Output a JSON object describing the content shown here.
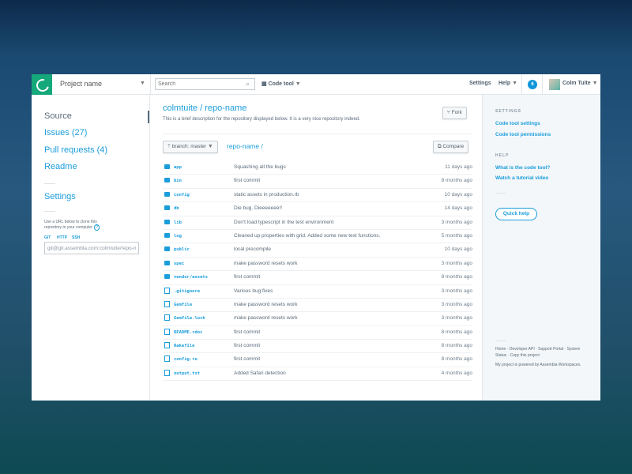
{
  "topbar": {
    "project": "Project name",
    "search_placeholder": "Search",
    "code_tool": "Code tool",
    "settings": "Settings",
    "help": "Help",
    "notifications": "6",
    "user": "Colm Tuite"
  },
  "sidebar": {
    "items": [
      {
        "label": "Source"
      },
      {
        "label": "Issues (27)"
      },
      {
        "label": "Pull requests (4)"
      },
      {
        "label": "Readme"
      }
    ],
    "settings": "Settings",
    "clone_hint": "Use a URL below to clone this repository to your computer.",
    "help_glyph": "?",
    "protocols": [
      "GIT",
      "HTTP",
      "SSH"
    ],
    "clone_url": "git@git.assembla.com:colmtuite/repo-name.git"
  },
  "main": {
    "title": "colmtuite / repo-name",
    "description": "This is a brief description for the repository displayed below. It is a very nice repository indeed.",
    "fork": "Fork",
    "branch": "branch: master",
    "crumb": "repo-name /",
    "compare": "Compare",
    "files": [
      {
        "name": "app",
        "type": "folder",
        "message": "Squashing all the bugs",
        "age": "11 days ago"
      },
      {
        "name": "bin",
        "type": "folder",
        "message": "first commit",
        "age": "8 months ago"
      },
      {
        "name": "config",
        "type": "folder",
        "message": "static assets in production.rb",
        "age": "10 days ago"
      },
      {
        "name": "db",
        "type": "folder",
        "message": "Die bug. Dieeeeeee!!",
        "age": "14 days ago"
      },
      {
        "name": "lib",
        "type": "folder",
        "message": "Don't load typescript in the test environment",
        "age": "3 months ago"
      },
      {
        "name": "log",
        "type": "folder",
        "message": "Cleaned up properties with grid. Added some new text functions.",
        "age": "5 months ago"
      },
      {
        "name": "public",
        "type": "folder",
        "message": "local precompile",
        "age": "10 days ago"
      },
      {
        "name": "spec",
        "type": "folder",
        "message": "make password resets work",
        "age": "3 months ago"
      },
      {
        "name": "vendor/assets",
        "type": "folder",
        "message": "first commit",
        "age": "8 months ago"
      },
      {
        "name": ".gitignore",
        "type": "file",
        "message": "Various bug fixes",
        "age": "3 months ago"
      },
      {
        "name": "Gemfile",
        "type": "file",
        "message": "make password resets work",
        "age": "3 months ago"
      },
      {
        "name": "Gemfile.lock",
        "type": "file",
        "message": "make password resets work",
        "age": "3 months ago"
      },
      {
        "name": "README.rdoc",
        "type": "file",
        "message": "first commit",
        "age": "8 months ago"
      },
      {
        "name": "Rakefile",
        "type": "file",
        "message": "first commit",
        "age": "8 months ago"
      },
      {
        "name": "config.ru",
        "type": "file",
        "message": "first commit",
        "age": "8 months ago"
      },
      {
        "name": "output.txt",
        "type": "file",
        "message": "Added Safari detection",
        "age": "4 months ago"
      }
    ]
  },
  "right": {
    "settings_heading": "SETTINGS",
    "settings_links": [
      "Code tool settings",
      "Code tool permissions"
    ],
    "help_heading": "HELP",
    "help_links": [
      "What is the code tool?",
      "Watch a tutorial video"
    ],
    "quick_help": "Quick help",
    "footer_links": "Home · Developer API · Support Portal · System Status · Copy this project",
    "powered": "My project is powered by Assembla Workspaces."
  }
}
